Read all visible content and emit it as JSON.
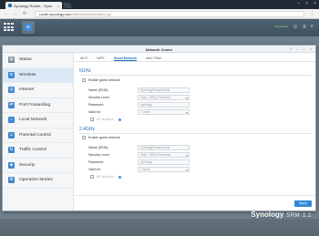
{
  "browser": {
    "tab_title": "Synology Router - Syno",
    "tab_close": "×",
    "url_host": "router.synology.com",
    "url_path": ":8000/webman/index.cgi",
    "nav_back": "←",
    "nav_forward": "→",
    "nav_reload": "⟳",
    "menu": "⋮",
    "window_min": "–",
    "window_max": "□",
    "window_close": "×"
  },
  "srm_bar": {
    "main_menu_icon": "grid-icon",
    "active_app_icon": "wifi-icon",
    "status": "Connected",
    "status_sub": "",
    "user_icon": "user-icon",
    "options_icon": "options-icon",
    "search_icon": "search-icon"
  },
  "window": {
    "title": "Network Center",
    "ctrl_help": "?",
    "ctrl_min": "–",
    "ctrl_max": "□",
    "ctrl_close": "×"
  },
  "sidebar": {
    "items": [
      {
        "label": "Status",
        "icon": "status-icon"
      },
      {
        "label": "Wireless",
        "icon": "wireless-icon",
        "active": true
      },
      {
        "label": "Internet",
        "icon": "globe-icon"
      },
      {
        "label": "Port Forwarding",
        "icon": "port-forward-icon"
      },
      {
        "label": "Local Network",
        "icon": "lan-icon"
      },
      {
        "label": "Parental Control",
        "icon": "parental-icon"
      },
      {
        "label": "Traffic Control",
        "icon": "traffic-icon"
      },
      {
        "label": "Security",
        "icon": "shield-icon"
      },
      {
        "label": "Operation Modes",
        "icon": "modes-icon"
      }
    ]
  },
  "tabs": [
    {
      "label": "Wi-Fi"
    },
    {
      "label": "WPS"
    },
    {
      "label": "Guest Network",
      "active": true
    },
    {
      "label": "MAC Filter"
    }
  ],
  "band_5ghz": {
    "title": "5GHz",
    "enable_label": "Enable guest network",
    "name_label": "Name (SSID):",
    "name_value": "SynologyRouterGuest",
    "security_label": "Security Level:",
    "security_value": "High - WPA2-Personal",
    "password_label": "Password:",
    "password_value": "synology",
    "valid_label": "Valid for:",
    "valid_value": "1 week",
    "isolation_label": "AP isolation"
  },
  "band_24ghz": {
    "title": "2.4GHz",
    "enable_label": "Enable guest network",
    "name_label": "Name (SSID):",
    "name_value": "SynologyRouterGuest",
    "security_label": "Security Level:",
    "security_value": "High - WPA2-Personal",
    "password_label": "Password:",
    "password_value": "synology",
    "valid_label": "Valid for:",
    "valid_value": "1 week",
    "isolation_label": "AP isolation"
  },
  "footer": {
    "apply_label": "Apply"
  },
  "brand": {
    "name": "Synology",
    "product": "SRM",
    "version": "1.1"
  },
  "colors": {
    "accent": "#2f86d6",
    "sidebar_active": "#dbe9f7",
    "desktop": "#6f7f8c"
  }
}
